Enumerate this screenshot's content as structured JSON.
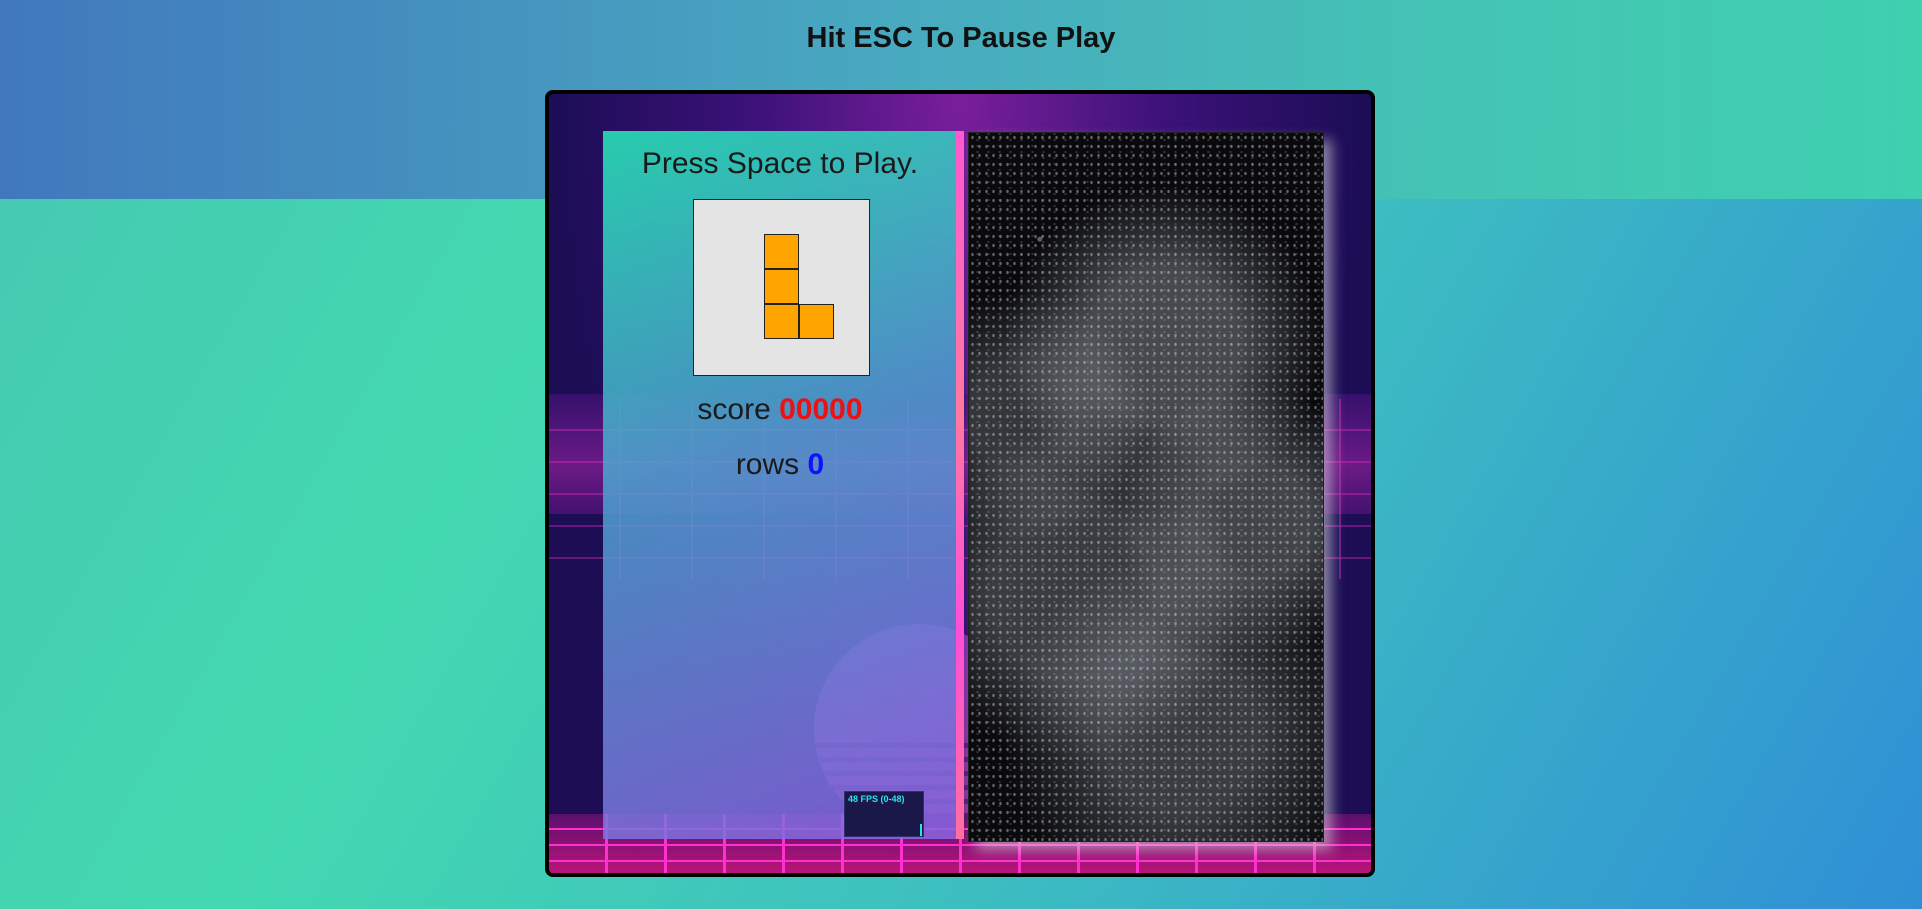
{
  "header": {
    "title": "Hit ESC To Pause Play"
  },
  "side_panel": {
    "prompt": "Press Space to Play.",
    "next_piece": {
      "shape": "L",
      "color": "#ffa500"
    },
    "score_label": "score",
    "score_value": "00000",
    "rows_label": "rows",
    "rows_value": "0"
  },
  "fps_meter": {
    "label": "48 FPS (0-48)"
  },
  "colors": {
    "score": "#ee1111",
    "rows": "#1111ff",
    "piece": "#ffa500"
  }
}
